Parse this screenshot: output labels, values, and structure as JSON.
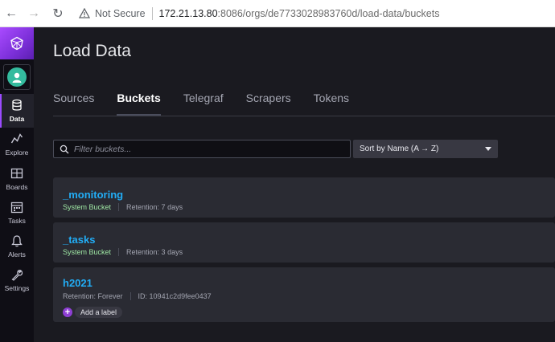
{
  "browser": {
    "not_secure": "Not Secure",
    "url_host": "172.21.13.80",
    "url_rest": ":8086/orgs/de7733028983760d/load-data/buckets"
  },
  "nav": {
    "items": [
      {
        "label": "Data",
        "icon": "database-icon"
      },
      {
        "label": "Explore",
        "icon": "graph-icon"
      },
      {
        "label": "Boards",
        "icon": "dashboard-icon"
      },
      {
        "label": "Tasks",
        "icon": "calendar-icon"
      },
      {
        "label": "Alerts",
        "icon": "bell-icon"
      },
      {
        "label": "Settings",
        "icon": "wrench-icon"
      }
    ],
    "active": "Data"
  },
  "page": {
    "title": "Load Data",
    "tabs": [
      "Sources",
      "Buckets",
      "Telegraf",
      "Scrapers",
      "Tokens"
    ],
    "active_tab": "Buckets"
  },
  "search": {
    "placeholder": "Filter buckets...",
    "value": ""
  },
  "sort": {
    "selected": "Sort by Name (A → Z)"
  },
  "buckets": [
    {
      "name": "_monitoring",
      "type": "System Bucket",
      "retention": "Retention: 7 days"
    },
    {
      "name": "_tasks",
      "type": "System Bucket",
      "retention": "Retention: 3 days"
    },
    {
      "name": "h2021",
      "retention": "Retention: Forever",
      "id": "ID: 10941c2d9fee0437",
      "add_label": "Add a label"
    }
  ],
  "colors": {
    "accent": "#9b4bff",
    "bucket_name": "#22adf6",
    "system_bucket": "#9ee6a3"
  }
}
